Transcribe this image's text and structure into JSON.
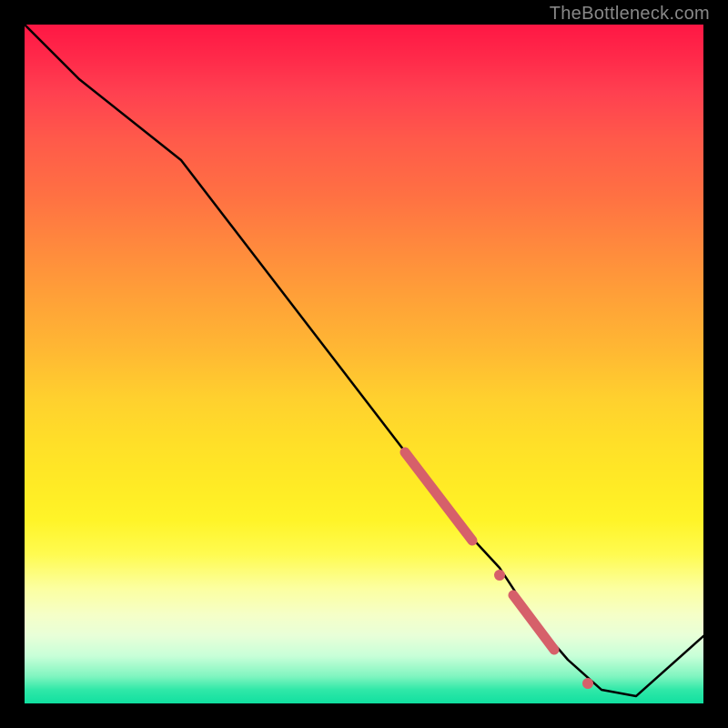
{
  "watermark": "TheBottleneck.com",
  "chart_data": {
    "type": "line",
    "title": "",
    "xlabel": "",
    "ylabel": "",
    "xlim": [
      0,
      100
    ],
    "ylim": [
      0,
      100
    ],
    "series": [
      {
        "name": "bottleneck-curve",
        "x": [
          0,
          8,
          23,
          60,
          65,
          70,
          75,
          80,
          85,
          90,
          100
        ],
        "y": [
          100,
          92,
          80,
          32,
          25,
          18,
          12,
          6,
          2,
          1,
          10
        ],
        "color": "#000000"
      }
    ],
    "highlights": [
      {
        "name": "highlight-segment-1",
        "x_range": [
          56,
          66
        ],
        "y_range": [
          37,
          24
        ],
        "color": "#d6606a"
      },
      {
        "name": "highlight-dot-1",
        "x": 70,
        "y": 18,
        "color": "#d6606a"
      },
      {
        "name": "highlight-segment-2",
        "x_range": [
          72,
          78
        ],
        "y_range": [
          15,
          8
        ],
        "color": "#d6606a"
      },
      {
        "name": "highlight-dot-2",
        "x": 83,
        "y": 3,
        "color": "#d6606a"
      }
    ]
  }
}
